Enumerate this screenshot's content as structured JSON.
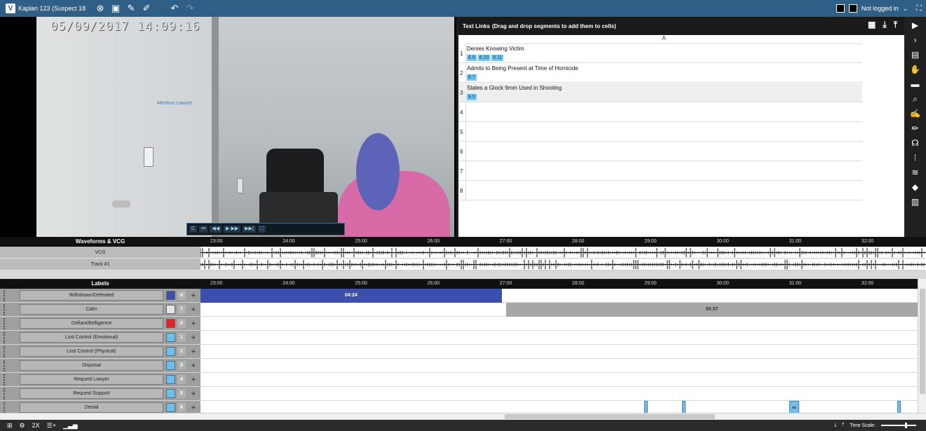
{
  "topbar": {
    "title": "Kaplan 123 (Suspect 18",
    "user_status": "Not logged in",
    "tools": [
      "close-icon",
      "save-icon",
      "pencil-icon",
      "tag-pencil-icon",
      "undo-icon",
      "redo-icon"
    ]
  },
  "video": {
    "timestamp": "05/09/2017 14:09:16",
    "room_label": "Mentour Lawyer",
    "player_buttons": [
      "C",
      "⏮",
      "◀◀",
      "▶ ▶▶",
      "▶▶|",
      "⛶"
    ]
  },
  "text_links": {
    "title": "Text Links",
    "subtitle": "(Drag and drop segments to add them to cells)",
    "column_header": "A",
    "rows": [
      {
        "num": "1",
        "text": "Denies Knowing Victim",
        "segments": [
          "6.9",
          "6.10",
          "6.11"
        ]
      },
      {
        "num": "2",
        "text": "Admits to Being Present at Time of Homicide",
        "segments": [
          "8.7"
        ]
      },
      {
        "num": "3",
        "text": "States a Glock 9mm Used in Shooting",
        "segments": [
          "8.9"
        ]
      },
      {
        "num": "4",
        "text": "",
        "segments": []
      },
      {
        "num": "5",
        "text": "",
        "segments": []
      },
      {
        "num": "6",
        "text": "",
        "segments": []
      },
      {
        "num": "7",
        "text": "",
        "segments": []
      },
      {
        "num": "8",
        "text": "",
        "segments": []
      }
    ]
  },
  "waveforms": {
    "header": "Waveforms & VCG",
    "tracks": [
      "VCG",
      "Track #1"
    ]
  },
  "ruler_ticks": [
    "23:00",
    "24:00",
    "25:00",
    "26:00",
    "27:00",
    "28:00",
    "29:00",
    "30:00",
    "31:00",
    "32:00"
  ],
  "labels": {
    "header": "Labels",
    "rows": [
      {
        "name": "Withdrawn/Defeated",
        "color": "#3c4fae",
        "key": "d"
      },
      {
        "name": "Calm",
        "color": "#e6e6e6",
        "key": "f"
      },
      {
        "name": "Defiant/Belligerent",
        "color": "#e6232b",
        "key": "0"
      },
      {
        "name": "Lost Control (Emotional)",
        "color": "#6ac1ee",
        "key": "1"
      },
      {
        "name": "Lost Control (Physical)",
        "color": "#6ac1ee",
        "key": "2"
      },
      {
        "name": "Disposal",
        "color": "#6ac1ee",
        "key": "3"
      },
      {
        "name": "Request Lawyer",
        "color": "#6ac1ee",
        "key": "4"
      },
      {
        "name": "Request Support",
        "color": "#6ac1ee",
        "key": "5"
      },
      {
        "name": "Denial",
        "color": "#6ac1ee",
        "key": "6"
      }
    ],
    "segments": [
      {
        "label": "04:24",
        "row": 0,
        "start": 0,
        "end": 0.42,
        "color": "#3c4fae",
        "text_color": "#ffffff"
      },
      {
        "label": "05:37",
        "row": 1,
        "start": 0.426,
        "end": 1.0,
        "color": "#a7a7a7",
        "text_color": "#333333"
      }
    ],
    "denial_markers": [
      {
        "pos": 0.619,
        "label": ""
      },
      {
        "pos": 0.672,
        "label": ""
      },
      {
        "pos": 0.821,
        "label": "∞"
      },
      {
        "pos": 0.972,
        "label": ""
      }
    ]
  },
  "bottombar": {
    "zoom": "2X",
    "time_scale_label": "Time Scale:"
  }
}
